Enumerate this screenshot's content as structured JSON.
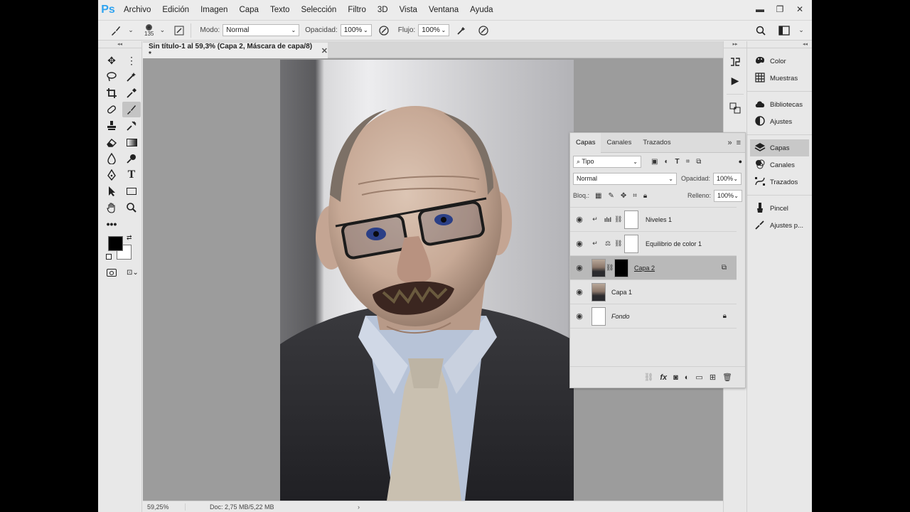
{
  "app": {
    "logo": "Ps"
  },
  "menu": [
    "Archivo",
    "Edición",
    "Imagen",
    "Capa",
    "Texto",
    "Selección",
    "Filtro",
    "3D",
    "Vista",
    "Ventana",
    "Ayuda"
  ],
  "window_controls": {
    "minimize": "▬",
    "restore": "❐",
    "close": "✕"
  },
  "options": {
    "brush_size": "135",
    "mode_label": "Modo:",
    "mode_value": "Normal",
    "opacity_label": "Opacidad:",
    "opacity_value": "100%",
    "flow_label": "Flujo:",
    "flow_value": "100%"
  },
  "document": {
    "tab_title": "Sin título-1 al 59,3% (Capa 2, Máscara de capa/8) *",
    "zoom": "59,25%",
    "doc_info": "Doc: 2,75 MB/5,22 MB"
  },
  "right_panels": {
    "group1": [
      "Color",
      "Muestras"
    ],
    "group2": [
      "Bibliotecas",
      "Ajustes"
    ],
    "group3": [
      "Capas",
      "Canales",
      "Trazados"
    ],
    "group4": [
      "Pincel",
      "Ajustes p..."
    ],
    "active": "Capas"
  },
  "layers_panel": {
    "tabs": [
      "Capas",
      "Canales",
      "Trazados"
    ],
    "active_tab": "Capas",
    "filter_value": "Tipo",
    "blend_mode": "Normal",
    "opacity_label": "Opacidad:",
    "opacity_value": "100%",
    "lock_label": "Bloq.:",
    "fill_label": "Relleno:",
    "fill_value": "100%",
    "layers": [
      {
        "name": "Niveles 1",
        "type": "adjustment",
        "selected": false
      },
      {
        "name": "Equilibrio de color 1",
        "type": "adjustment",
        "selected": false
      },
      {
        "name": "Capa 2",
        "type": "masked",
        "selected": true
      },
      {
        "name": "Capa 1",
        "type": "photo",
        "selected": false
      },
      {
        "name": "Fondo",
        "type": "background",
        "selected": false
      }
    ]
  }
}
